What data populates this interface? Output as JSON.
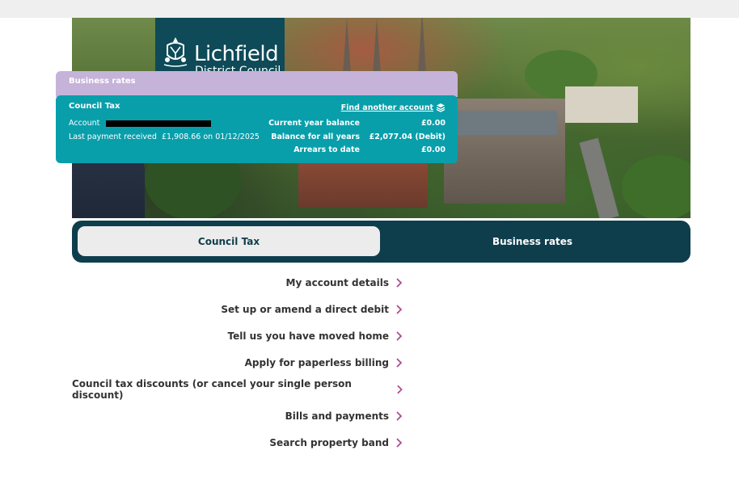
{
  "brand": {
    "name": "Lichfield",
    "sub": "District Council",
    "color_panel": "#0e4a58"
  },
  "business_strip": {
    "label": "Business rates"
  },
  "tax_panel": {
    "title": "Council Tax",
    "find_link": "Find another account",
    "account_label": "Account",
    "last_payment_label": "Last payment received",
    "last_payment_value": "£1,908.66 on 01/12/2025",
    "summary": [
      {
        "label": "Current year balance",
        "value": "£0.00"
      },
      {
        "label": "Balance for all years",
        "value": "£2,077.04 (Debit)"
      },
      {
        "label": "Arrears to date",
        "value": "£0.00"
      }
    ]
  },
  "tabs": [
    {
      "label": "Council Tax",
      "active": true
    },
    {
      "label": "Business rates",
      "active": false
    }
  ],
  "links": [
    {
      "label": "My account details"
    },
    {
      "label": "Set up or amend a direct debit"
    },
    {
      "label": "Tell us you have moved home"
    },
    {
      "label": "Apply for paperless billing"
    },
    {
      "label": "Council tax discounts (or cancel your single person discount)"
    },
    {
      "label": "Bills and payments"
    },
    {
      "label": "Search property band"
    }
  ],
  "colors": {
    "teal": "#089fab",
    "purple": "#c6b3d9",
    "navy": "#0e3e4c",
    "chevron": "#b04a8e"
  },
  "icons": {
    "find": "stack-icon",
    "link": "chevron-right-icon"
  }
}
